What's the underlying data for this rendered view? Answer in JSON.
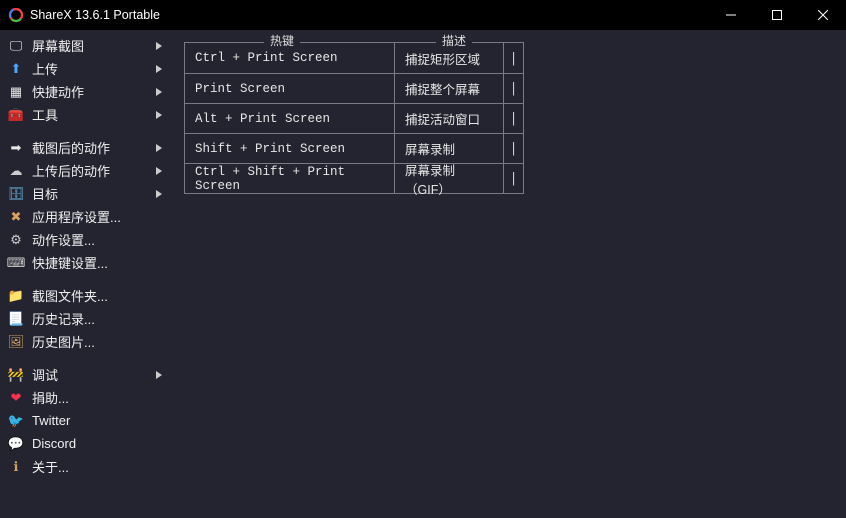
{
  "window": {
    "title": "ShareX 13.6.1 Portable"
  },
  "sidebar": {
    "items": [
      {
        "icon": "screenshot-icon",
        "label": "屏幕截图",
        "submenu": true
      },
      {
        "icon": "upload-icon",
        "label": "上传",
        "submenu": true
      },
      {
        "icon": "shortcut-actions-icon",
        "label": "快捷动作",
        "submenu": true
      },
      {
        "icon": "tools-icon",
        "label": "工具",
        "submenu": true
      },
      {
        "icon": "after-capture-icon",
        "label": "截图后的动作",
        "submenu": true,
        "sep": true
      },
      {
        "icon": "after-upload-icon",
        "label": "上传后的动作",
        "submenu": true
      },
      {
        "icon": "destinations-icon",
        "label": "目标",
        "submenu": true
      },
      {
        "icon": "app-settings-icon",
        "label": "应用程序设置...",
        "submenu": false
      },
      {
        "icon": "task-settings-icon",
        "label": "动作设置...",
        "submenu": false
      },
      {
        "icon": "hotkey-settings-icon",
        "label": "快捷键设置...",
        "submenu": false
      },
      {
        "icon": "screenshots-folder-icon",
        "label": "截图文件夹...",
        "submenu": false,
        "sep": true
      },
      {
        "icon": "history-icon",
        "label": "历史记录...",
        "submenu": false
      },
      {
        "icon": "image-history-icon",
        "label": "历史图片...",
        "submenu": false
      },
      {
        "icon": "debug-icon",
        "label": "调试",
        "submenu": true,
        "sep": true
      },
      {
        "icon": "donate-icon",
        "label": "捐助...",
        "submenu": false
      },
      {
        "icon": "twitter-icon",
        "label": "Twitter",
        "submenu": false
      },
      {
        "icon": "discord-icon",
        "label": "Discord",
        "submenu": false
      },
      {
        "icon": "about-icon",
        "label": "关于...",
        "submenu": false
      }
    ]
  },
  "hotkeys": {
    "header_key": "热键",
    "header_desc": "描述",
    "rows": [
      {
        "key": "Ctrl + Print Screen",
        "desc": "捕捉矩形区域"
      },
      {
        "key": "Print Screen",
        "desc": "捕捉整个屏幕"
      },
      {
        "key": "Alt + Print Screen",
        "desc": "捕捉活动窗口"
      },
      {
        "key": "Shift + Print Screen",
        "desc": "屏幕录制"
      },
      {
        "key": "Ctrl + Shift + Print Screen",
        "desc": "屏幕录制（GIF）"
      }
    ],
    "edit_glyph": "|"
  },
  "sidebar_icons": {
    "screenshot-icon": "🖵",
    "upload-icon": "⬆",
    "shortcut-actions-icon": "▦",
    "tools-icon": "🧰",
    "after-capture-icon": "➡",
    "after-upload-icon": "☁",
    "destinations-icon": "🗄",
    "app-settings-icon": "✖",
    "task-settings-icon": "⚙",
    "hotkey-settings-icon": "⌨",
    "screenshots-folder-icon": "📁",
    "history-icon": "📃",
    "image-history-icon": "🖼",
    "debug-icon": "🚧",
    "donate-icon": "❤",
    "twitter-icon": "🐦",
    "discord-icon": "💬",
    "about-icon": "ℹ"
  },
  "icon_color": {
    "upload-icon": "#4da6ff",
    "tools-icon": "#c04030",
    "after-upload-icon": "#cccccc",
    "destinations-icon": "#6fb7e8",
    "app-settings-icon": "#d9a060",
    "task-settings-icon": "#cccccc",
    "hotkey-settings-icon": "#cccccc",
    "history-icon": "#d0a060",
    "image-history-icon": "#d0a060",
    "debug-icon": "#e07040",
    "donate-icon": "#ff3050",
    "twitter-icon": "#4da6ff",
    "discord-icon": "#6a78d1",
    "about-icon": "#d0a060"
  }
}
